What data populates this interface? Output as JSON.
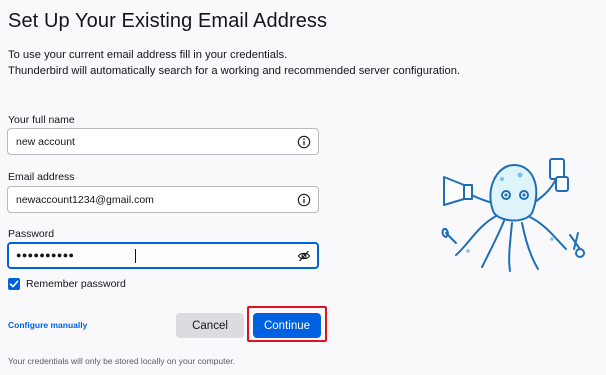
{
  "page": {
    "title": "Set Up Your Existing Email Address",
    "intro_line1": "To use your current email address fill in your credentials.",
    "intro_line2": "Thunderbird will automatically search for a working and recommended server configuration."
  },
  "form": {
    "full_name": {
      "label": "Your full name",
      "value": "new account",
      "icon": "info-icon"
    },
    "email": {
      "label": "Email address",
      "value": "newaccount1234@gmail.com",
      "icon": "info-icon"
    },
    "password": {
      "label": "Password",
      "masked_value": "●●●●●●●●●●",
      "icon": "eye-slash-icon"
    },
    "remember_password": {
      "label": "Remember password",
      "checked": true
    }
  },
  "actions": {
    "configure_manually": "Configure manually",
    "cancel": "Cancel",
    "continue": "Continue"
  },
  "footer": {
    "note": "Your credentials will only be stored locally on your computer."
  },
  "colors": {
    "accent": "#0061e0",
    "highlight": "#e0141f",
    "mascot_fill": "#dff3fb",
    "mascot_outline": "#1f6fb8"
  }
}
